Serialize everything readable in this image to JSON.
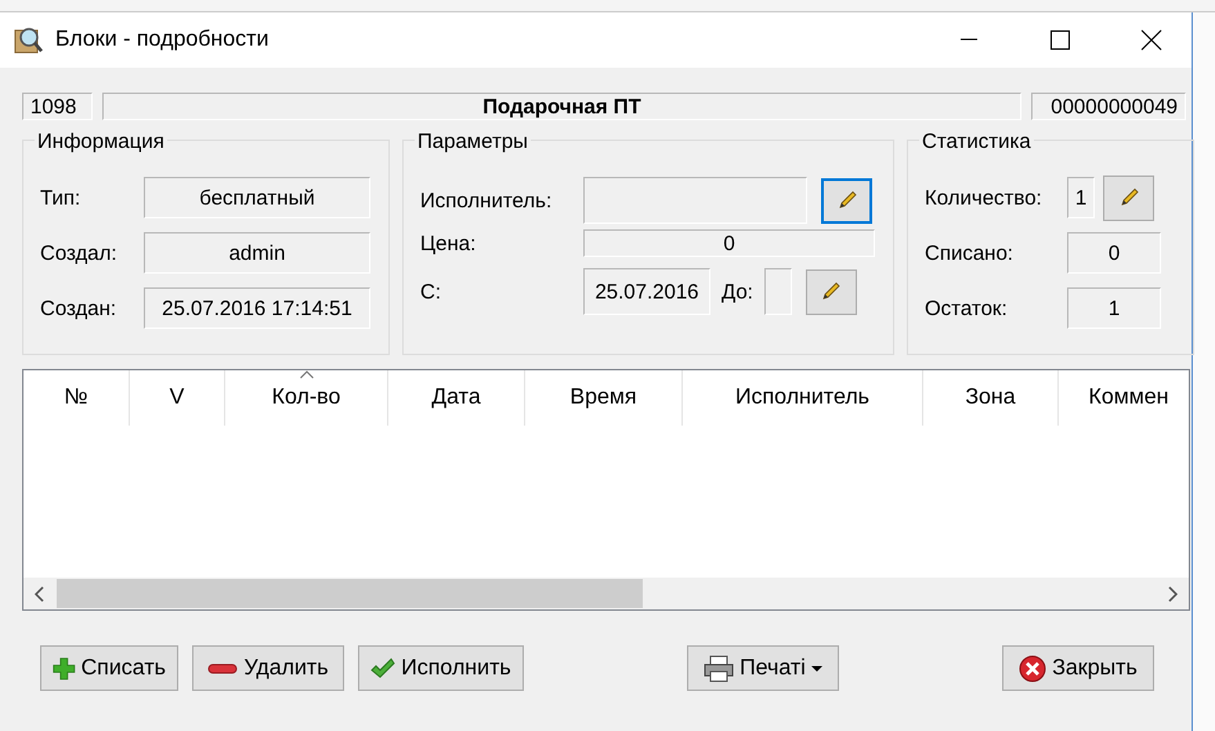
{
  "window": {
    "title": "Блоки - подробности"
  },
  "header": {
    "id": "1098",
    "name": "Подарочная ПТ",
    "code": "00000000049"
  },
  "info": {
    "title": "Информация",
    "fields": [
      {
        "label": "Тип:",
        "value": "бесплатный"
      },
      {
        "label": "Создал:",
        "value": "admin"
      },
      {
        "label": "Создан:",
        "value": "25.07.2016 17:14:51"
      }
    ]
  },
  "params": {
    "title": "Параметры",
    "performer_label": "Исполнитель:",
    "performer_edit_focused": true,
    "price_label": "Цена:",
    "price": "0",
    "from_label": "С:",
    "from": "25.07.2016",
    "to_label": "До:"
  },
  "stats": {
    "title": "Статистика",
    "fields": [
      {
        "label": "Количество:",
        "value": "1",
        "editable": true
      },
      {
        "label": "Списано:",
        "value": "0",
        "editable": false
      },
      {
        "label": "Остаток:",
        "value": "1",
        "editable": false
      }
    ]
  },
  "table": {
    "columns": [
      {
        "label": "№",
        "sorted": false
      },
      {
        "label": "V",
        "sorted": false
      },
      {
        "label": "Кол-во",
        "sorted": true
      },
      {
        "label": "Дата",
        "sorted": false
      },
      {
        "label": "Время",
        "sorted": false
      },
      {
        "label": "Исполнитель",
        "sorted": false
      },
      {
        "label": "Зона",
        "sorted": false
      },
      {
        "label": "Коммен",
        "sorted": false
      }
    ]
  },
  "buttons": [
    {
      "label": "Списать",
      "kind": "add"
    },
    {
      "label": "Удалить",
      "kind": "delete"
    },
    {
      "label": "Исполнить",
      "kind": "execute"
    },
    {
      "label": "Печаті",
      "kind": "print"
    },
    {
      "label": "Закрыть",
      "kind": "close"
    }
  ]
}
